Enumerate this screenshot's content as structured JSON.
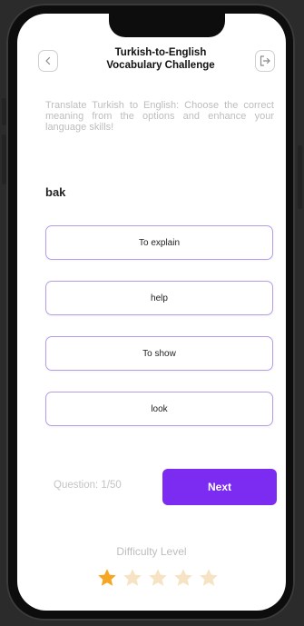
{
  "app": {
    "title_line1": "Turkish-to-English",
    "title_line2": "Vocabulary Challenge",
    "instructions": "Translate Turkish to English: Choose the correct meaning from the options and enhance your language skills!",
    "word": "bak",
    "options": [
      {
        "label": "To explain"
      },
      {
        "label": "help"
      },
      {
        "label": "To show"
      },
      {
        "label": "look"
      }
    ],
    "question_counter": "Question: 1/50",
    "next_label": "Next",
    "difficulty_label": "Difficulty Level",
    "difficulty_rating": 1,
    "difficulty_max": 5
  },
  "icons": {
    "back": "chevron-left-icon",
    "exit": "logout-icon",
    "star": "star-icon"
  },
  "colors": {
    "accent": "#7b2cf0",
    "option_border": "#b79de6",
    "star_active": "#f5a623",
    "star_inactive": "#f6e3c3"
  }
}
